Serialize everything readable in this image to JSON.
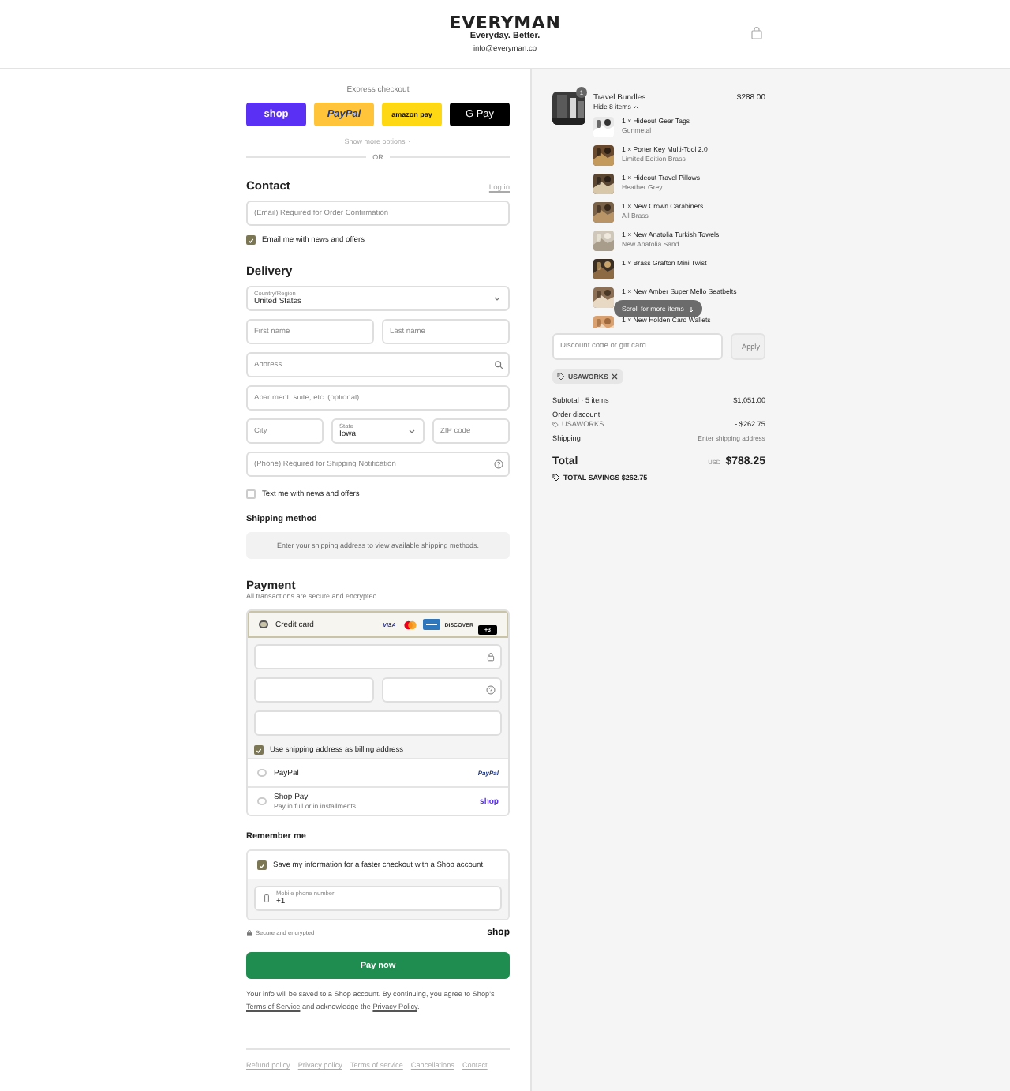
{
  "header": {
    "logo": "EVERYMAN",
    "tagline": "Everyday. Better.",
    "email": "info@everyman.co"
  },
  "express": {
    "title": "Express checkout",
    "buttons": [
      {
        "kind": "shop",
        "label": "shop"
      },
      {
        "kind": "paypal",
        "label": "PayPal"
      },
      {
        "kind": "amazon",
        "label": "amazon pay"
      },
      {
        "kind": "gpay",
        "label": "G Pay"
      }
    ],
    "more": "Show more options",
    "divider": "OR"
  },
  "contact": {
    "heading": "Contact",
    "login": "Log in",
    "email_placeholder": "(Email) Required for Order Confirmation",
    "news": {
      "label": "Email me with news and offers",
      "checked": true
    }
  },
  "delivery": {
    "heading": "Delivery",
    "rows": [
      [
        {
          "kind": "select",
          "label": "Country/Region",
          "value": "United States"
        }
      ],
      [
        {
          "kind": "text",
          "placeholder": "First name"
        },
        {
          "kind": "text",
          "placeholder": "Last name"
        }
      ],
      [
        {
          "kind": "search",
          "placeholder": "Address"
        }
      ],
      [
        {
          "kind": "text",
          "placeholder": "Apartment, suite, etc. (optional)"
        }
      ],
      [
        {
          "kind": "text",
          "placeholder": "City"
        },
        {
          "kind": "select",
          "label": "State",
          "value": "Iowa"
        },
        {
          "kind": "text",
          "placeholder": "ZIP code"
        }
      ],
      [
        {
          "kind": "help",
          "placeholder": "(Phone) Required for Shipping Notification"
        }
      ]
    ],
    "sms": {
      "label": "Text me with news and offers",
      "checked": false
    }
  },
  "shipping": {
    "heading": "Shipping method",
    "notice": "Enter your shipping address to view available shipping methods."
  },
  "payment": {
    "heading": "Payment",
    "subtitle": "All transactions are secure and encrypted.",
    "methods": [
      {
        "kind": "card",
        "label": "Credit card",
        "selected": true,
        "logos": [
          {
            "kind": "visa",
            "text": "VISA"
          },
          {
            "kind": "mastercard"
          },
          {
            "kind": "amex"
          },
          {
            "kind": "discover",
            "text": "DISCOVER"
          },
          {
            "kind": "more",
            "text": "+3"
          }
        ],
        "card_fields": [
          {
            "kind": "number"
          },
          {
            "kind": "expiry"
          },
          {
            "kind": "cvv"
          },
          {
            "kind": "name"
          }
        ],
        "billing": {
          "label": "Use shipping address as billing address",
          "checked": true
        }
      },
      {
        "kind": "paypal",
        "label": "PayPal",
        "selected": false,
        "logo": "PayPal"
      },
      {
        "kind": "shop",
        "label": "Shop Pay",
        "sublabel": "Pay in full or in installments",
        "selected": false,
        "logo": "shop"
      }
    ]
  },
  "remember": {
    "heading": "Remember me",
    "save": {
      "label": "Save my information for a faster checkout with a Shop account",
      "checked": true
    },
    "phone": {
      "label": "Mobile phone number",
      "value": "+1"
    },
    "secure": "Secure and encrypted",
    "brand": "shop"
  },
  "pay_button": "Pay now",
  "legal": [
    {
      "kind": "text",
      "text": "Your info will be saved to a Shop account. By continuing, you agree to Shop's "
    },
    {
      "kind": "link",
      "text": "Terms of Service"
    },
    {
      "kind": "text",
      "text": " and acknowledge the "
    },
    {
      "kind": "link",
      "text": "Privacy Policy"
    },
    {
      "kind": "text",
      "text": "."
    }
  ],
  "footer_links": [
    "Refund policy",
    "Privacy policy",
    "Terms of service",
    "Cancellations",
    "Contact"
  ],
  "summary": {
    "bundle": {
      "name": "Travel Bundles",
      "price": "$288.00",
      "quantity": "1",
      "toggle": "Hide 8 items",
      "items": [
        {
          "name": "1 × Hideout Gear Tags",
          "variant": "Gunmetal"
        },
        {
          "name": "1 × Porter Key Multi-Tool 2.0",
          "variant": "Limited Edition Brass"
        },
        {
          "name": "1 × Hideout Travel Pillows",
          "variant": "Heather Grey"
        },
        {
          "name": "1 × New Crown Carabiners",
          "variant": "All Brass"
        },
        {
          "name": "1 × New Anatolia Turkish Towels",
          "variant": "New Anatolia Sand"
        },
        {
          "name": "1 × Brass Grafton Mini Twist"
        },
        {
          "name": "1 × New Amber Super Mello Seatbelts"
        },
        {
          "name": "1 × New Holden Card Wallets"
        }
      ],
      "scroll_hint": "Scroll for more items"
    },
    "discount": {
      "placeholder": "Discount code or gift card",
      "apply": "Apply",
      "tag": "USAWORKS"
    },
    "subtotal": {
      "label": "Subtotal · 5 items",
      "value": "$1,051.00"
    },
    "order_discount": {
      "label": "Order discount",
      "code": "USAWORKS",
      "value": "- $262.75"
    },
    "shipping": {
      "label": "Shipping",
      "value": "Enter shipping address"
    },
    "total": {
      "label": "Total",
      "currency": "USD",
      "value": "$788.25"
    },
    "savings": "TOTAL SAVINGS $262.75"
  }
}
